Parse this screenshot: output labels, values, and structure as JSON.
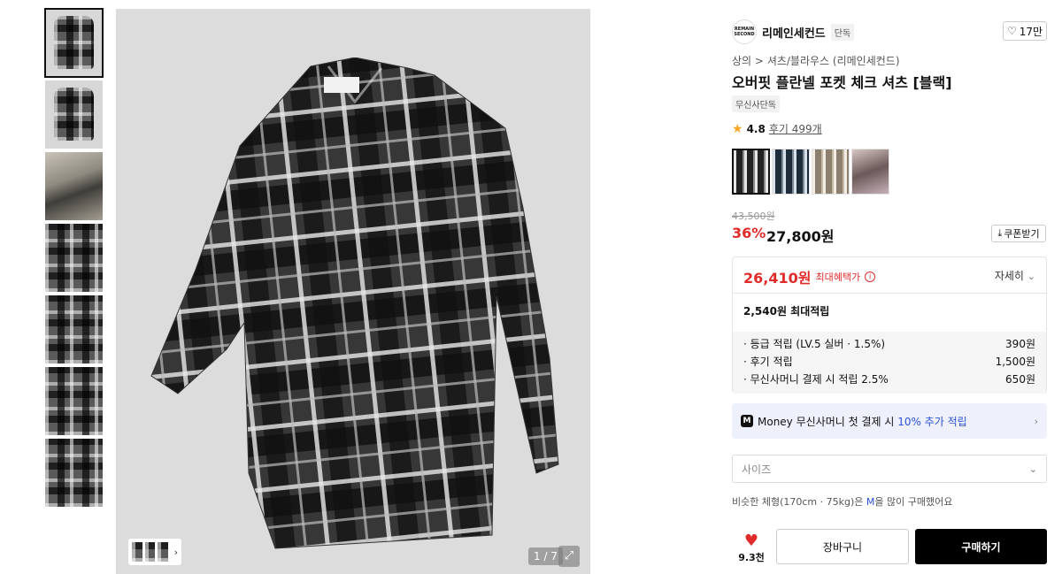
{
  "thumbnails": [
    "shirt-front",
    "shirt-flat",
    "model-photo",
    "detail-collar",
    "detail-pocket",
    "detail-fabric",
    "detail-fabric-2"
  ],
  "gallery": {
    "counter": "1 / 7"
  },
  "brand": {
    "logo_text": "REMAIN SECOND",
    "name": "리메인세컨드",
    "badge": "단독"
  },
  "like": {
    "count": "17만"
  },
  "breadcrumb": {
    "cat1": "상의",
    "sep": ">",
    "cat2": "셔츠/블라우스 (리메인세컨드)"
  },
  "product": {
    "title": "오버핏 플란넬 포켓 체크 셔츠 [블랙]",
    "tag": "무신사단독"
  },
  "rating": {
    "score": "4.8",
    "reviews": "후기 499개"
  },
  "colors": [
    "black",
    "navy",
    "beige",
    "model"
  ],
  "price": {
    "original": "43,500원",
    "discount": "36%",
    "sale": "27,800원",
    "coupon_label": "쿠폰받기"
  },
  "benefit": {
    "max_price": "26,410원",
    "max_label": "최대혜택가",
    "detail_label": "자세히",
    "points_total": "2,540원 최대적립",
    "rows": [
      {
        "label": "· 등급 적립 (LV.5 실버 · 1.5%)",
        "value": "390원"
      },
      {
        "label": "· 후기 적립",
        "value": "1,500원"
      },
      {
        "label": "· 무신사머니 결제 시 적립 2.5%",
        "value": "650원"
      }
    ]
  },
  "money": {
    "badge": "M",
    "prefix": "Money 무신사머니 첫 결제 시 ",
    "highlight": "10% 추가 적립"
  },
  "size": {
    "placeholder": "사이즈"
  },
  "fit": {
    "prefix": "비슷한 체형(170cm · 75kg)은 ",
    "size": "M",
    "suffix": "을 많이 구매했어요"
  },
  "wish": {
    "count": "9.3천"
  },
  "actions": {
    "cart": "장바구니",
    "buy": "구매하기"
  },
  "colors_hex": {
    "accent_red": "#e02b2b",
    "accent_blue": "#2a52d6"
  }
}
